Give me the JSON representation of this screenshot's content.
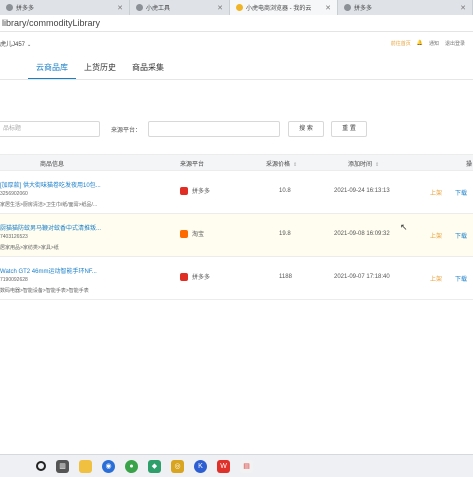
{
  "browser": {
    "tabs": [
      {
        "label": "拼多多",
        "active": false
      },
      {
        "label": "小虎工具",
        "active": false
      },
      {
        "label": "小虎电商浏览器 - 我的云",
        "active": true
      },
      {
        "label": "拼多多",
        "active": false
      }
    ],
    "url": "library/commodityLibrary"
  },
  "appbar": {
    "user": "虎儿J457",
    "links": [
      "前往首页",
      "通知",
      "退出登录"
    ]
  },
  "page_tabs": [
    "云商品库",
    "上货历史",
    "商品采集"
  ],
  "filters": {
    "search_placeholder": "品标题",
    "source_label": "来源平台：",
    "search_button": "搜 索",
    "reset_button": "重 置"
  },
  "table": {
    "headers": {
      "info": "商品信息",
      "platform": "来源平台",
      "price": "采源价格",
      "time": "添加时间",
      "ops": "操"
    },
    "rows": [
      {
        "title": "[加厚款] 供大街味猫卷吃发夜用10包...",
        "code": "3256902060",
        "cats": "家居生活>厨房清洁>卫生巾/纸/面膏>纸品/...",
        "platform": "拼多多",
        "platform_color": "#e02e24",
        "price": "10.8",
        "time": "2021-09-24 16:13:13",
        "action1": "上架",
        "action2": "下载",
        "highlighted": false
      },
      {
        "title": "厨猫猫防蚊男马鞭对蚊香中式清推叛...",
        "code": "7403126523",
        "cats": "居家用品>家纺类>家具>纸",
        "platform": "淘宝",
        "platform_color": "#ff6a00",
        "price": "19.8",
        "time": "2021-09-08 16:09:32",
        "action1": "上架",
        "action2": "下载",
        "highlighted": true
      },
      {
        "title": "Watch GT2 46mm运动智能手环NF...",
        "code": "7190092628",
        "cats": "数码电器>智能设备>智能手表>智能手表",
        "platform": "拼多多",
        "platform_color": "#e02e24",
        "price": "1188",
        "time": "2021-09-07 17:18:40",
        "action1": "上架",
        "action2": "下载",
        "highlighted": false
      }
    ]
  },
  "taskbar": {
    "icons": [
      "search-icon",
      "task-view-icon",
      "file-explorer-icon",
      "browser-icon",
      "wechat-icon",
      "wechat-work-icon",
      "app-icon",
      "kugou-icon",
      "wps-icon",
      "wps-office-icon"
    ]
  }
}
